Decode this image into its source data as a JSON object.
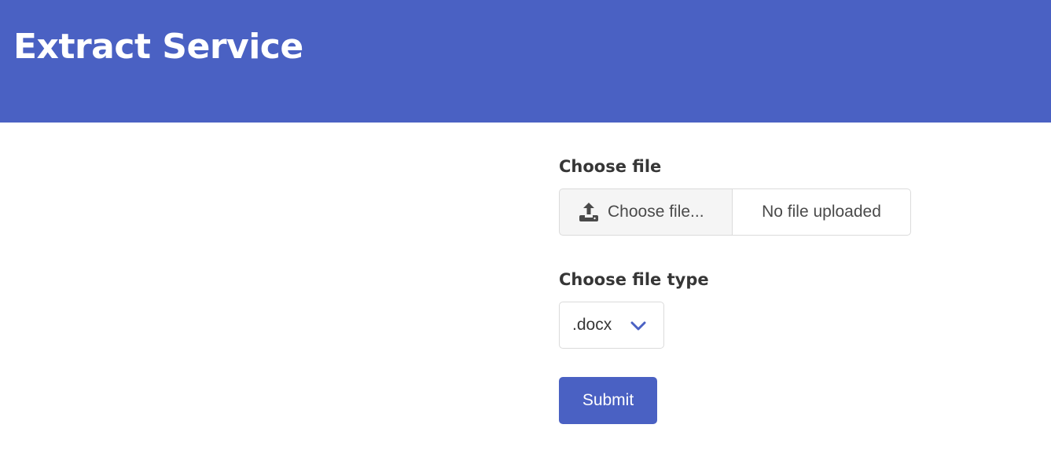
{
  "header": {
    "title": "Extract Service"
  },
  "form": {
    "file_label": "Choose file",
    "file_button_label": "Choose file...",
    "file_name": "No file uploaded",
    "file_type_label": "Choose file type",
    "file_type_selected": ".docx",
    "submit_label": "Submit"
  },
  "icons": {
    "upload": "upload-icon",
    "select_chevron": "chevron-down-icon"
  },
  "colors": {
    "brand": "#4a61c3",
    "text": "#363636",
    "border": "#dbdbdb",
    "file_cta_bg": "#f5f5f5"
  }
}
